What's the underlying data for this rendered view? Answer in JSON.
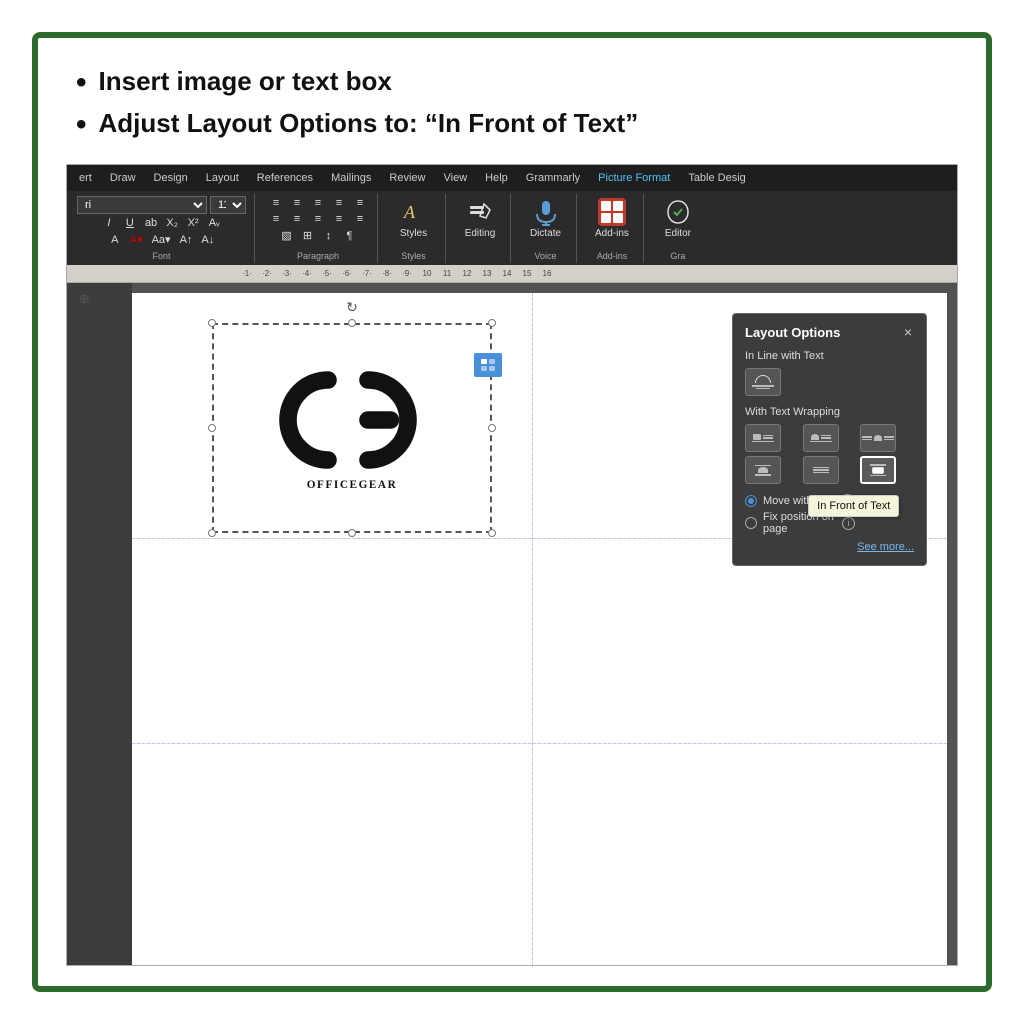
{
  "outer": {
    "bullet1": "Insert image or text box",
    "bullet2": "Adjust Layout Options to: “In Front of Text”"
  },
  "ribbon": {
    "tabs": [
      {
        "label": "ert",
        "active": false
      },
      {
        "label": "Draw",
        "active": false
      },
      {
        "label": "Design",
        "active": false
      },
      {
        "label": "Layout",
        "active": false
      },
      {
        "label": "References",
        "active": false
      },
      {
        "label": "Mailings",
        "active": false
      },
      {
        "label": "Review",
        "active": false
      },
      {
        "label": "View",
        "active": false
      },
      {
        "label": "Help",
        "active": false
      },
      {
        "label": "Grammarly",
        "active": false
      },
      {
        "label": "Picture Format",
        "active": true
      },
      {
        "label": "Table Desig",
        "active": false
      }
    ],
    "groups": {
      "font": {
        "label": "Font",
        "font_name": "ri",
        "font_size": "11"
      },
      "paragraph": {
        "label": "Paragraph"
      },
      "styles": {
        "label": "Styles",
        "btn_label": "Styles"
      },
      "editing": {
        "label": "Editing",
        "btn_label": "Editing"
      },
      "voice": {
        "label": "Voice",
        "btn_label": "Dictate"
      },
      "addins": {
        "label": "Add-ins",
        "btn_label": "Add-ins"
      },
      "editor": {
        "label": "Gra",
        "btn_label": "Editor"
      }
    }
  },
  "layout_panel": {
    "title": "Layout Options",
    "close_btn": "×",
    "section_inline": "In Line with Text",
    "section_wrapping": "With Text Wrapping",
    "radio1_label": "Move with text",
    "radio2_label": "Fix position on\npage",
    "see_more": "See more...",
    "tooltip": "In Front of Text"
  },
  "image": {
    "alt": "OfficeGear logo",
    "company_name": "OfficeGear"
  }
}
